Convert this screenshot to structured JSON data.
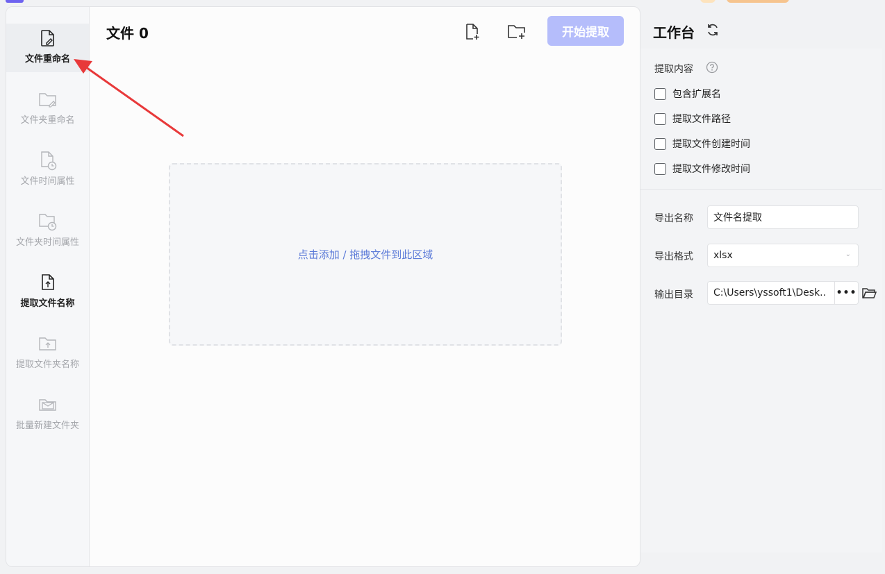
{
  "header": {
    "title": "文件 0",
    "start_button": "开始提取"
  },
  "sidebar": {
    "items": [
      {
        "label": "文件重命名",
        "icon": "file-edit-icon",
        "state": "active"
      },
      {
        "label": "文件夹重命名",
        "icon": "folder-edit-icon",
        "state": "inactive"
      },
      {
        "label": "文件时间属性",
        "icon": "file-clock-icon",
        "state": "inactive"
      },
      {
        "label": "文件夹时间属性",
        "icon": "folder-clock-icon",
        "state": "inactive"
      },
      {
        "label": "提取文件名称",
        "icon": "file-upload-icon",
        "state": "current"
      },
      {
        "label": "提取文件夹名称",
        "icon": "folder-upload-icon",
        "state": "inactive"
      },
      {
        "label": "批量新建文件夹",
        "icon": "folder-mail-icon",
        "state": "inactive"
      }
    ]
  },
  "dropzone": {
    "text": "点击添加 / 拖拽文件到此区域"
  },
  "workbench": {
    "title": "工作台",
    "extract_section_label": "提取内容",
    "checkboxes": [
      {
        "label": "包含扩展名",
        "checked": false
      },
      {
        "label": "提取文件路径",
        "checked": false
      },
      {
        "label": "提取文件创建时间",
        "checked": false
      },
      {
        "label": "提取文件修改时间",
        "checked": false
      }
    ],
    "export_name_label": "导出名称",
    "export_name_value": "文件名提取",
    "export_format_label": "导出格式",
    "export_format_value": "xlsx",
    "output_dir_label": "输出目录",
    "output_dir_value": "C:\\Users\\yssoft1\\Desk..",
    "dots_label": "•••"
  },
  "colors": {
    "accent": "#b5bdfb",
    "link": "#5b7ad8",
    "arrow": "#e8393a"
  }
}
